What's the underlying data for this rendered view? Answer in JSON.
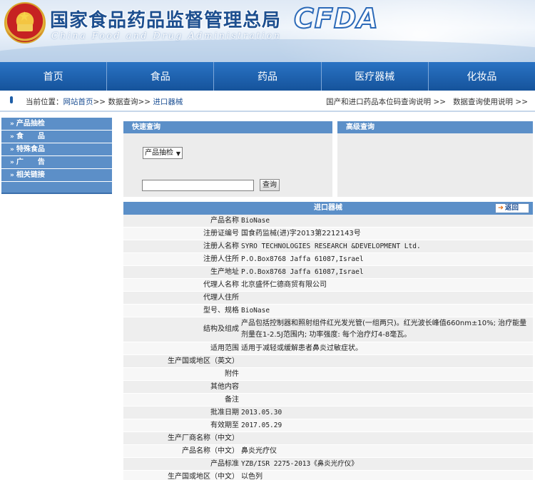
{
  "header": {
    "cn_title": "国家食品药品监督管理总局",
    "en_title": "China Food and Drug Administration",
    "logo_text": "CFDA"
  },
  "nav": [
    "首页",
    "食品",
    "药品",
    "医疗器械",
    "化妆品"
  ],
  "breadcrumb": {
    "prefix": "当前位置：",
    "home": "网站首页",
    "sep1": ">>",
    "level2": "数据查询",
    "sep2": ">>",
    "level3": "进口器械",
    "right_links": [
      "国产和进口药品本位码查询说明 >>",
      "数据查询使用说明 >>"
    ]
  },
  "sidebar": {
    "arrow": "»",
    "items": [
      "产品抽检",
      "食　　品",
      "特殊食品",
      "广　　告",
      "相关链接"
    ]
  },
  "quick_search": {
    "title": "快速查询",
    "select_value": "产品抽检",
    "button_label": "查询",
    "input_value": ""
  },
  "advanced_search": {
    "title": "高级查询"
  },
  "detail": {
    "title": "进口器械",
    "back_label": "返回",
    "rows": [
      {
        "label": "产品名称",
        "value": "BioNase"
      },
      {
        "label": "注册证编号",
        "value": "国食药监械(进)字2013第2212143号"
      },
      {
        "label": "注册人名称",
        "value": "SYRO TECHNOLOGIES RESEARCH &DEVELOPMENT Ltd."
      },
      {
        "label": "注册人住所",
        "value": "P.O.Box8768 Jaffa 61087,Israel"
      },
      {
        "label": "生产地址",
        "value": "P.O.Box8768 Jaffa 61087,Israel"
      },
      {
        "label": "代理人名称",
        "value": "北京盛怀仁德商贸有限公司"
      },
      {
        "label": "代理人住所",
        "value": ""
      },
      {
        "label": "型号、规格",
        "value": "BioNase"
      },
      {
        "label": "结构及组成",
        "value": "产品包括控制器和照射组件红光发光管(一组两只)。红光波长峰值660nm±10%; 治疗能量剂量在1-2.5J范围内; 功率强度: 每个治疗灯4-8毫瓦。"
      },
      {
        "label": "适用范围",
        "value": "适用于减轻或缓解患者鼻炎过敏症状。"
      },
      {
        "label": "生产国或地区（英文）",
        "value": ""
      },
      {
        "label": "附件",
        "value": ""
      },
      {
        "label": "其他内容",
        "value": ""
      },
      {
        "label": "备注",
        "value": ""
      },
      {
        "label": "批准日期",
        "value": "2013.05.30"
      },
      {
        "label": "有效期至",
        "value": "2017.05.29"
      },
      {
        "label": "生产厂商名称（中文）",
        "value": ""
      },
      {
        "label": "产品名称（中文）",
        "value": "鼻炎光疗仪"
      },
      {
        "label": "产品标准",
        "value": "YZB/ISR 2275-2013《鼻炎光疗仪》"
      },
      {
        "label": "生产国或地区（中文）",
        "value": "以色列"
      }
    ]
  },
  "colors": {
    "nav_blue": "#1b5fae",
    "panel_blue": "#5b8fc8",
    "title_blue": "#1d4f8f"
  }
}
